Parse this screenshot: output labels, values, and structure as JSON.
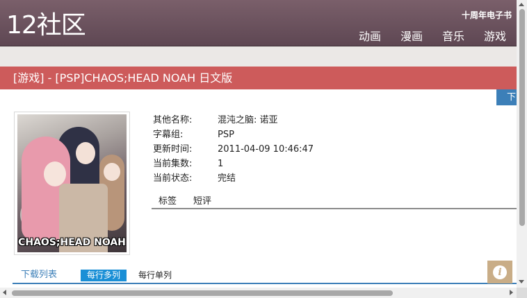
{
  "header": {
    "logo": "12社区",
    "top_link": "十周年电子书",
    "nav": [
      "动画",
      "漫画",
      "音乐",
      "游戏"
    ]
  },
  "page_title": "[游戏] - [PSP]CHAOS;HEAD NOAH 日文版",
  "download_button": "下载",
  "cover": {
    "text": "CHAOS;HEAD NOAH"
  },
  "info": [
    {
      "label": "其他名称:",
      "value": "混沌之脑: 诺亚"
    },
    {
      "label": "字幕组:",
      "value": "PSP"
    },
    {
      "label": "更新时间:",
      "value": "2011-04-09 10:46:47"
    },
    {
      "label": "当前集数:",
      "value": "1"
    },
    {
      "label": "当前状态:",
      "value": "完结"
    }
  ],
  "tabs": [
    "标签",
    "短评"
  ],
  "download_list": {
    "title": "下载列表",
    "options": [
      "每行多列",
      "每行单列"
    ]
  },
  "colors": {
    "header": "#6b5560",
    "title_bar": "#cd5b5b",
    "accent_blue": "#3c7fb8",
    "option_active": "#1a8fd6",
    "help_button": "#c9ad87"
  },
  "icons": {
    "help": "info-icon"
  }
}
